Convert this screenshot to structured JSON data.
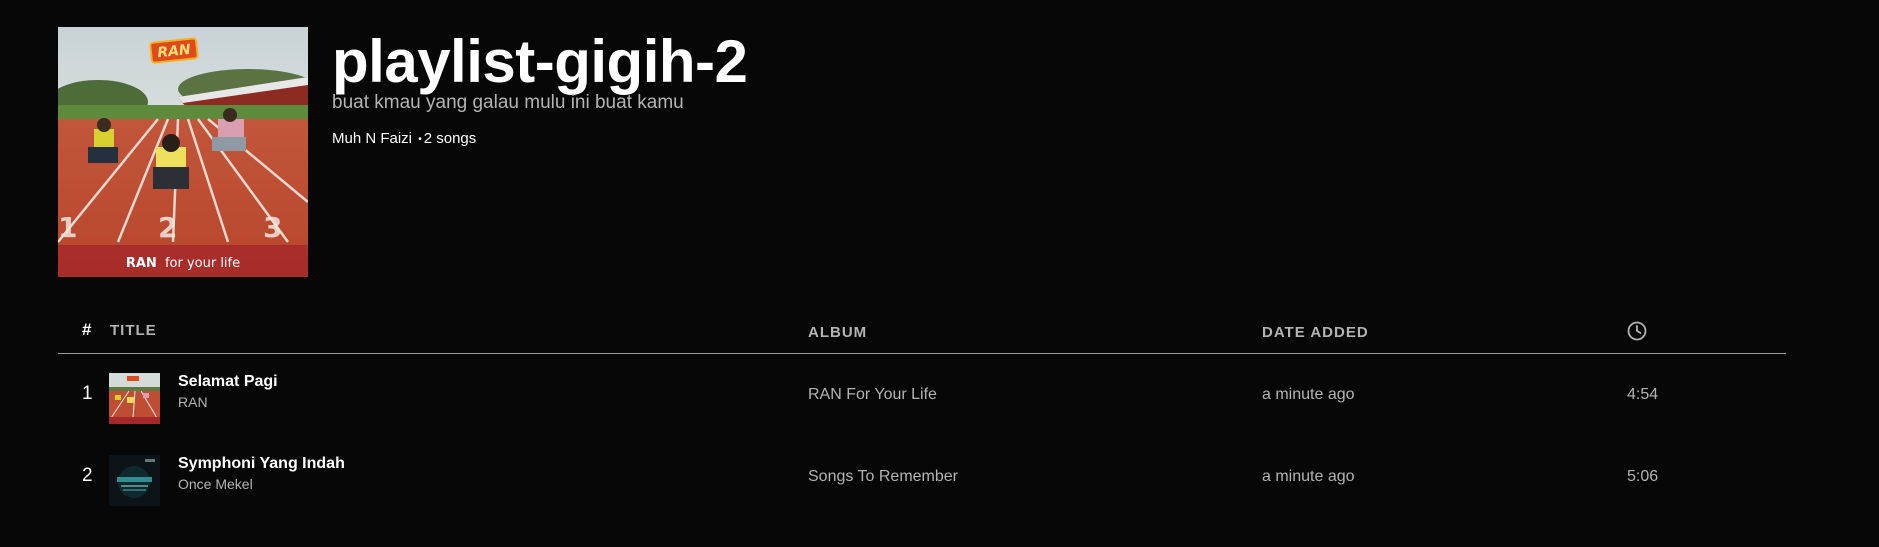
{
  "playlist": {
    "title": "playlist-gigih-2",
    "description": "buat kmau yang galau mulu ini buat kamu",
    "owner": "Muh N Faizi",
    "separator": "•",
    "song_count": "2 songs",
    "cover_caption_artist": "RAN",
    "cover_caption_album": "for your life",
    "cover_logo_text": "RAN"
  },
  "table": {
    "headers": {
      "number": "#",
      "title": "TITLE",
      "album": "ALBUM",
      "date_added": "DATE ADDED",
      "duration_icon": "clock-icon"
    },
    "rows": [
      {
        "number": "1",
        "title": "Selamat Pagi",
        "artist": "RAN",
        "album": "RAN For Your Life",
        "date_added": "a minute ago",
        "duration": "4:54"
      },
      {
        "number": "2",
        "title": "Symphoni Yang Indah",
        "artist": "Once Mekel",
        "album": "Songs To Remember",
        "date_added": "a minute ago",
        "duration": "5:06"
      }
    ]
  },
  "colors": {
    "background": "#070707",
    "primary_text": "#ffffff",
    "secondary_text": "#b3b3b3",
    "divider": "#9a9a9a"
  }
}
